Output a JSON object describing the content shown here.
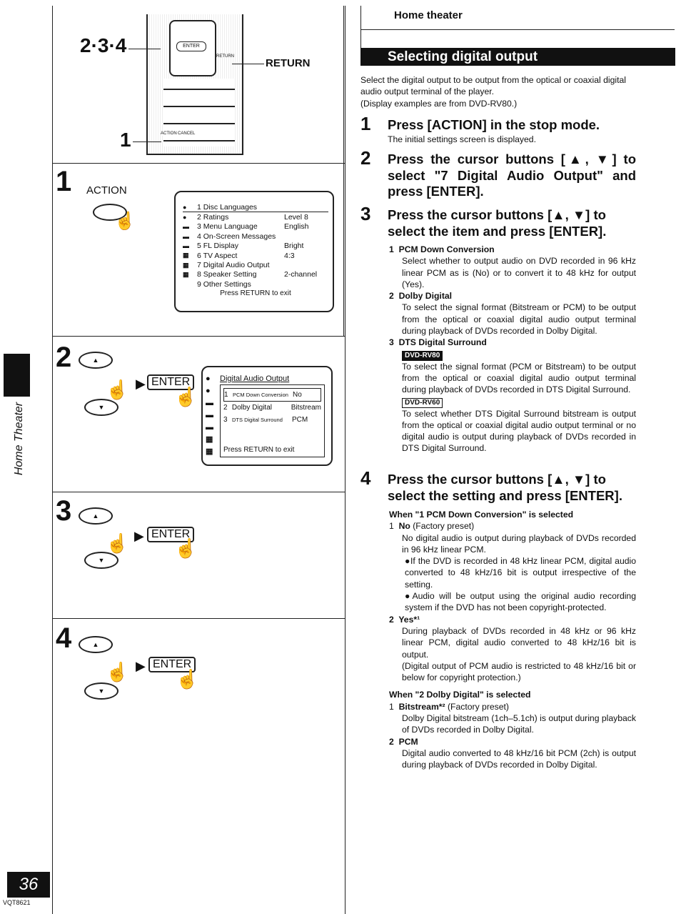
{
  "header": {
    "section": "Home theater",
    "title": "Selecting digital output"
  },
  "intro": [
    "Select the digital output to be output from the optical or coaxial digital audio output terminal of the player.",
    "(Display examples are from DVD-RV80.)"
  ],
  "steps": [
    {
      "num": "1",
      "title": "Press [ACTION] in the stop mode.",
      "desc": "The initial settings screen is displayed."
    },
    {
      "num": "2",
      "title": "Press the cursor buttons [▲, ▼] to select \"7 Digital Audio Output\" and press [ENTER]."
    },
    {
      "num": "3",
      "title": "Press the cursor buttons [▲, ▼] to select the item and press [ENTER]."
    },
    {
      "num": "4",
      "title": "Press the cursor buttons [▲, ▼] to select the setting and press [ENTER]."
    }
  ],
  "items3": [
    {
      "num": "1",
      "title": "PCM Down Conversion",
      "text": "Select whether to output audio on DVD recorded in 96 kHz linear PCM as is (No) or to convert it to 48 kHz for output (Yes)."
    },
    {
      "num": "2",
      "title": "Dolby Digital",
      "text": "To select the signal format (Bitstream or PCM) to be output from the optical or coaxial digital audio output terminal during playback of DVDs recorded in Dolby Digital."
    },
    {
      "num": "3",
      "title": "DTS Digital Surround",
      "badge1": "DVD-RV80",
      "text1": "To select the signal format (PCM or Bitstream) to be output from the optical or coaxial digital audio output terminal during playback of DVDs recorded in DTS Digital Surround.",
      "badge2": "DVD-RV60",
      "text2": "To select whether DTS Digital Surround bitstream is output from the optical or coaxial digital audio output terminal or no digital audio is output during playback of DVDs recorded in DTS Digital Surround."
    }
  ],
  "pcm": {
    "heading": "When \"1 PCM Down Conversion\" is selected",
    "opt1": {
      "num": "1",
      "name": "No",
      "note": "(Factory preset)",
      "text": "No digital audio is output during playback of DVDs recorded in 96 kHz linear PCM.",
      "b1": "●If the DVD is recorded in 48 kHz linear PCM, digital audio converted to 48 kHz/16 bit is output irrespective of the setting.",
      "b2": "●Audio will be output using the original audio recording system if the DVD has not been copyright-protected."
    },
    "opt2": {
      "num": "2",
      "name": "Yes*¹",
      "text": "During playback of DVDs recorded in 48 kHz or 96 kHz linear PCM, digital audio converted to 48 kHz/16 bit is output.",
      "text2": "(Digital output of PCM audio is restricted to 48 kHz/16 bit or below for copyright protection.)"
    }
  },
  "dolby": {
    "heading": "When \"2 Dolby Digital\" is selected",
    "opt1": {
      "num": "1",
      "name": "Bitstream*²",
      "note": "(Factory preset)",
      "text": "Dolby Digital bitstream (1ch–5.1ch) is output during playback of DVDs recorded in Dolby Digital."
    },
    "opt2": {
      "num": "2",
      "name": "PCM",
      "text": "Digital audio converted to 48 kHz/16 bit PCM (2ch) is output during playback of DVDs recorded in Dolby Digital."
    }
  },
  "left": {
    "remote_label_steps": "2·3·4",
    "remote_label_one": "1",
    "remote_return": "RETURN",
    "remote_keys": {
      "enter": "ENTER",
      "ret": "RETURN",
      "action": "ACTION",
      "cancel": "CANCEL"
    },
    "panel_nums": [
      "1",
      "2",
      "3",
      "4"
    ],
    "action_label": "ACTION",
    "enter": "ENTER",
    "menu": [
      {
        "label": "1 Disc Languages",
        "value": ""
      },
      {
        "label": "2 Ratings",
        "value": "Level 8"
      },
      {
        "label": "3 Menu Language",
        "value": "English"
      },
      {
        "label": "4 On-Screen Messages",
        "value": ""
      },
      {
        "label": "5 FL Display",
        "value": "Bright"
      },
      {
        "label": "6 TV Aspect",
        "value": "4:3"
      },
      {
        "label": "7 Digital Audio Output",
        "value": ""
      },
      {
        "label": "8 Speaker Setting",
        "value": "2-channel"
      },
      {
        "label": "9 Other Settings",
        "value": ""
      }
    ],
    "menu_exit": "Press RETURN to exit",
    "dao_title": "Digital Audio Output",
    "dao": [
      {
        "num": "1",
        "label": "PCM Down Conversion",
        "value": "No"
      },
      {
        "num": "2",
        "label": "Dolby Digital",
        "value": "Bitstream"
      },
      {
        "num": "3",
        "label": "DTS Digital Surround",
        "value": "PCM"
      }
    ],
    "dao_exit": "Press RETURN to exit"
  },
  "sidebar": {
    "tab": "Home Theater"
  },
  "footer": {
    "page": "36",
    "code": "VQT8621"
  }
}
